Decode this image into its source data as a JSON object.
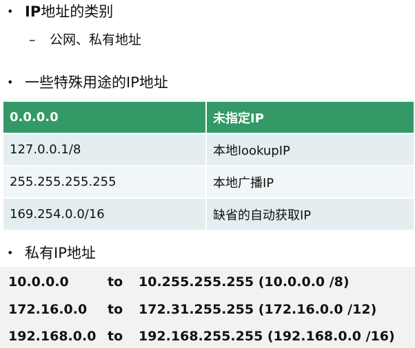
{
  "bullets": {
    "bullet_glyph": "•",
    "item1": {
      "bold": "IP",
      "rest": "地址的类别"
    },
    "item1_sub": {
      "dash": "–",
      "text": "公网、私有地址"
    },
    "item2": "一些特殊用途的IP地址",
    "item3": "私有IP地址"
  },
  "special_table": {
    "header": [
      "0.0.0.0",
      "未指定IP"
    ],
    "rows": [
      [
        "127.0.0.1/8",
        "本地lookupIP"
      ],
      [
        "255.255.255.255",
        "本地广播IP"
      ],
      [
        "169.254.0.0/16",
        "缺省的自动获取IP"
      ]
    ]
  },
  "private_ranges": {
    "to_word": "to",
    "rows": [
      {
        "start": "10.0.0.0",
        "end": "10.255.255.255 (10.0.0.0 /8)"
      },
      {
        "start": "172.16.0.0",
        "end": "172.31.255.255 (172.16.0.0 /12)"
      },
      {
        "start": "192.168.0.0",
        "end": "192.168.255.255 (192.168.0.0 /16)"
      }
    ]
  },
  "colors": {
    "table_header_bg": "#339966",
    "table_row_odd": "#e4eef0",
    "table_row_even": "#f1f6f8",
    "private_block_bg": "#f2f2f2"
  }
}
